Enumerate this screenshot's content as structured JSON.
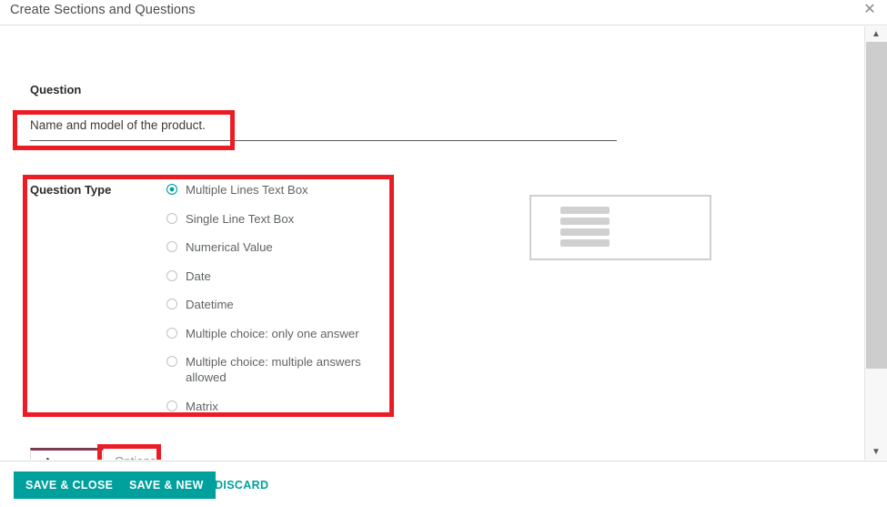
{
  "dialog": {
    "title": "Create Sections and Questions",
    "close_icon": "close-icon",
    "close_glyph": "✕"
  },
  "form": {
    "question_label": "Question",
    "question_value": "Name and model of the product.",
    "question_placeholder": "",
    "question_type_label": "Question Type",
    "question_types": [
      {
        "label": "Multiple Lines Text Box",
        "selected": true
      },
      {
        "label": "Single Line Text Box",
        "selected": false
      },
      {
        "label": "Numerical Value",
        "selected": false
      },
      {
        "label": "Date",
        "selected": false
      },
      {
        "label": "Datetime",
        "selected": false
      },
      {
        "label": "Multiple choice: only one answer",
        "selected": false
      },
      {
        "label": "Multiple choice: multiple answers allowed",
        "selected": false
      },
      {
        "label": "Matrix",
        "selected": false
      }
    ],
    "preview": {
      "icon": "multiline-text-preview-icon",
      "line_count": 4
    }
  },
  "tabs": [
    {
      "label": "Answers",
      "active": true
    },
    {
      "label": "Options",
      "active": false
    }
  ],
  "footer": {
    "save_close_label": "SAVE & CLOSE",
    "save_new_label": "SAVE & NEW",
    "discard_label": "DISCARD"
  },
  "scrollbar": {
    "up_glyph": "▲",
    "down_glyph": "▼"
  },
  "annotations": {
    "color": "#ec1c24",
    "boxes": [
      {
        "name": "question-input-highlight"
      },
      {
        "name": "question-type-highlight"
      },
      {
        "name": "options-tab-highlight"
      }
    ]
  },
  "colors": {
    "accent_teal": "#00a09d",
    "active_tab_border": "#7c3d54",
    "annotation_red": "#ec1c24"
  }
}
